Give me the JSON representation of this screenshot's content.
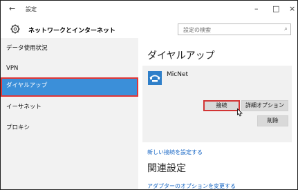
{
  "window": {
    "title": "設定",
    "back": "←",
    "minimize": "–",
    "maximize": "□",
    "close": "×"
  },
  "header": {
    "title": "ネットワークとインターネット",
    "search_placeholder": "設定の検索",
    "search_icon": "⌕"
  },
  "sidebar": {
    "items": [
      {
        "label": "データ使用状況",
        "active": false
      },
      {
        "label": "VPN",
        "active": false
      },
      {
        "label": "ダイヤルアップ",
        "active": true
      },
      {
        "label": "イーサネット",
        "active": false
      },
      {
        "label": "プロキシ",
        "active": false
      }
    ]
  },
  "main": {
    "heading": "ダイヤルアップ",
    "connection": {
      "name": "MicNet",
      "connect_label": "接続",
      "advanced_label": "詳細オプション",
      "delete_label": "削除"
    },
    "new_connection_link": "新しい接続を設定する",
    "related_heading": "関連設定",
    "adapter_link": "アダプターのオプションを変更する"
  },
  "colors": {
    "accent": "#3b8fd9",
    "highlight": "#e23535",
    "link": "#1666c5"
  }
}
